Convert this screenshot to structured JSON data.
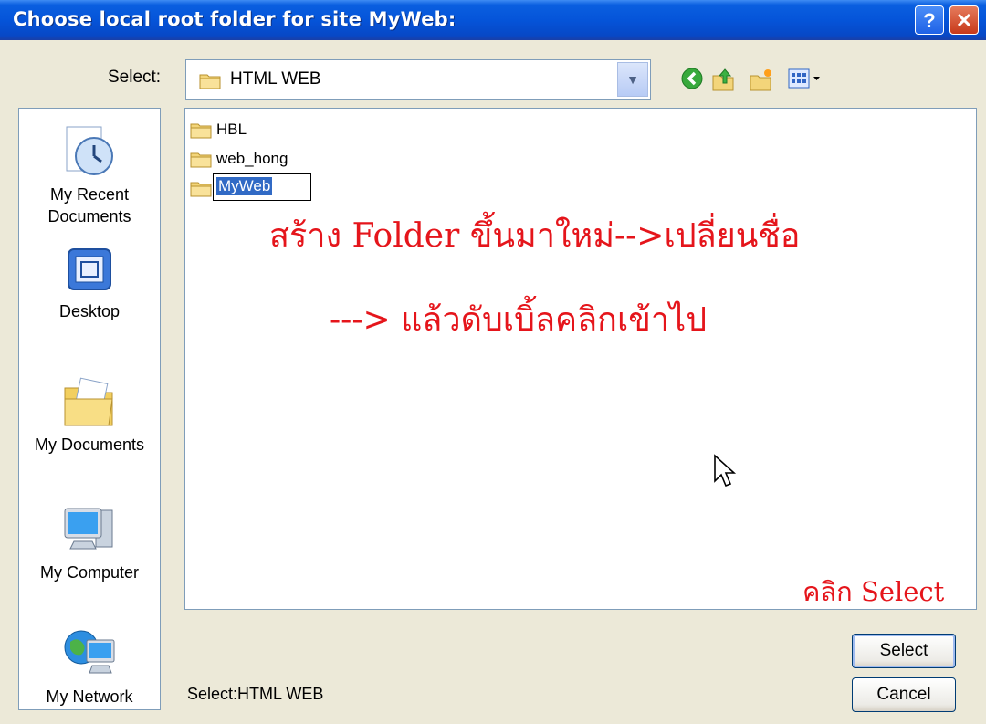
{
  "window": {
    "title": "Choose local root folder for site MyWeb:",
    "help_glyph": "?",
    "close_glyph": "✕"
  },
  "toolbar": {
    "select_label": "Select:",
    "current_folder": "HTML WEB",
    "icons": [
      "back-icon",
      "up-folder-icon",
      "new-folder-icon",
      "views-menu-icon"
    ]
  },
  "places": [
    {
      "label_line1": "My Recent",
      "label_line2": "Documents",
      "icon": "recent-documents-icon"
    },
    {
      "label_line1": "Desktop",
      "label_line2": "",
      "icon": "desktop-icon"
    },
    {
      "label_line1": "My Documents",
      "label_line2": "",
      "icon": "my-documents-icon"
    },
    {
      "label_line1": "My Computer",
      "label_line2": "",
      "icon": "my-computer-icon"
    },
    {
      "label_line1": "My Network",
      "label_line2": "",
      "icon": "my-network-icon"
    }
  ],
  "files": [
    {
      "name": "HBL"
    },
    {
      "name": "web_hong"
    },
    {
      "name": "MyWeb",
      "renaming": true
    }
  ],
  "annotations": {
    "line1": "สร้าง Folder ขึ้นมาใหม่-->เปลี่ยนชื่อ",
    "line2": "---> แล้วดับเบิ้ลคลิกเข้าไป",
    "click_hint": "คลิก Select",
    "color": "#e5151b"
  },
  "status": {
    "text": "Select:HTML WEB"
  },
  "buttons": {
    "select": "Select",
    "cancel": "Cancel"
  },
  "colors": {
    "titlebar": "#0554d9",
    "dialog_bg": "#ece9d8",
    "selection": "#316ac5"
  }
}
